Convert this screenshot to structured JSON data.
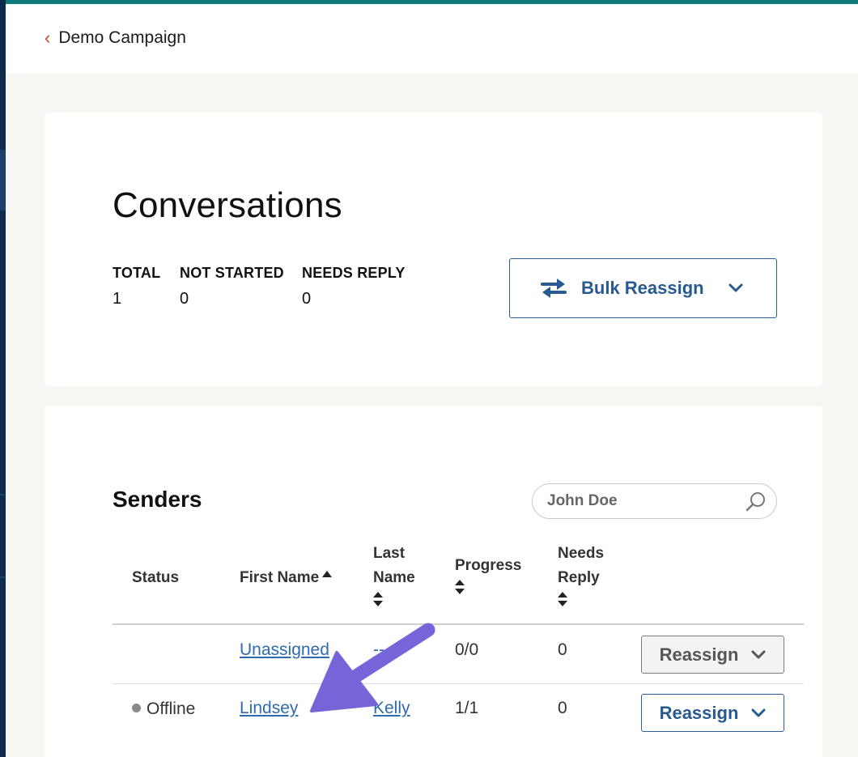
{
  "header": {
    "back_label": "Demo Campaign"
  },
  "conversations": {
    "title": "Conversations",
    "stats": [
      {
        "label": "TOTAL",
        "value": "1"
      },
      {
        "label": "NOT STARTED",
        "value": "0"
      },
      {
        "label": "NEEDS REPLY",
        "value": "0"
      }
    ],
    "bulk_reassign_label": "Bulk Reassign"
  },
  "senders": {
    "title": "Senders",
    "search_placeholder": "John Doe",
    "columns": {
      "status": "Status",
      "first_name": "First Name",
      "last_name_1": "Last",
      "last_name_2": "Name",
      "progress": "Progress",
      "needs_reply_1": "Needs",
      "needs_reply_2": "Reply"
    },
    "rows": [
      {
        "status": "",
        "first_name": "Unassigned",
        "last_name": "--",
        "progress": "0/0",
        "needs_reply": "0",
        "action": "Reassign",
        "action_state": "disabled"
      },
      {
        "status": "Offline",
        "first_name": "Lindsey",
        "last_name": "Kelly",
        "progress": "1/1",
        "needs_reply": "0",
        "action": "Reassign",
        "action_state": "active"
      }
    ]
  },
  "colors": {
    "accent": "#2a5d9a",
    "back_chevron": "#c2461e",
    "annotation_arrow": "#7565d8",
    "top_line": "#0f7a7d"
  }
}
